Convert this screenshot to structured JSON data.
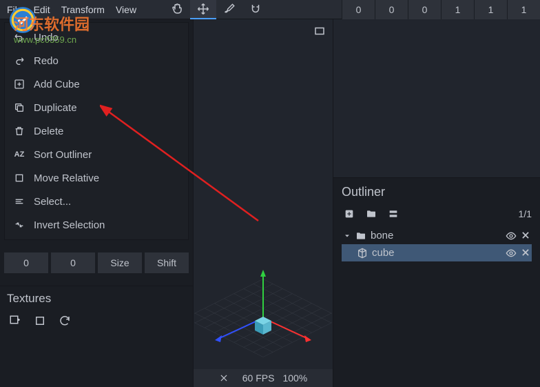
{
  "menubar": {
    "items": [
      "File",
      "Edit",
      "Transform",
      "View"
    ],
    "values": [
      "0",
      "0",
      "0",
      "1",
      "1",
      "1"
    ]
  },
  "dropdown": {
    "items": [
      {
        "label": "Undo",
        "icon": "undo"
      },
      {
        "label": "Redo",
        "icon": "redo"
      },
      {
        "label": "Add Cube",
        "icon": "plus"
      },
      {
        "label": "Duplicate",
        "icon": "copy"
      },
      {
        "label": "Delete",
        "icon": "trash"
      },
      {
        "label": "Sort Outliner",
        "icon": "sort"
      },
      {
        "label": "Move Relative",
        "icon": "square"
      },
      {
        "label": "Select...",
        "icon": "lines"
      },
      {
        "label": "Invert Selection",
        "icon": "invert"
      }
    ]
  },
  "controls": {
    "v1": "0",
    "v2": "0",
    "size": "Size",
    "shift": "Shift"
  },
  "textures": {
    "title": "Textures"
  },
  "status": {
    "fps": "60 FPS",
    "zoom": "100%"
  },
  "outliner": {
    "title": "Outliner",
    "count": "1/1",
    "bone": "bone",
    "cube": "cube"
  },
  "watermark": {
    "text": "河东软件园",
    "url": "www.pc0359.cn"
  }
}
